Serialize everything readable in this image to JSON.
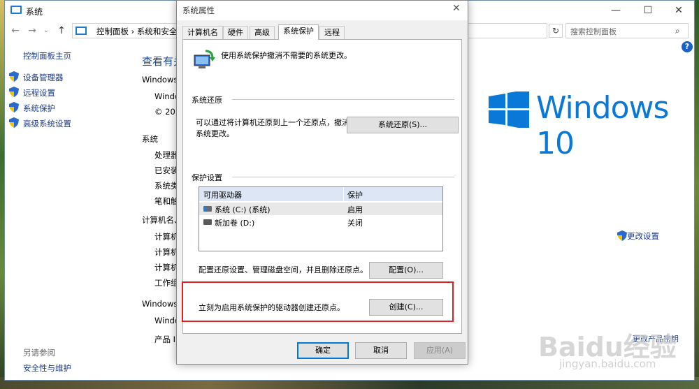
{
  "window": {
    "title": "系统",
    "controls": {
      "minimize": "—",
      "maximize": "☐",
      "close": "✕"
    }
  },
  "address": {
    "path": "控制面板  ›  系统和安全",
    "dropdown": "⌄",
    "refresh": "↻",
    "search_placeholder": "搜索控制面板"
  },
  "sidebar": {
    "home": "控制面板主页",
    "items": [
      {
        "label": "设备管理器"
      },
      {
        "label": "远程设置"
      },
      {
        "label": "系统保护"
      },
      {
        "label": "高级系统设置"
      }
    ],
    "see_also_title": "另请参阅",
    "see_also_link": "安全性与维护"
  },
  "main": {
    "heading": "查看有关",
    "windows_edition_label": "Windows",
    "windows_line": "Windo",
    "copyright": "© 201",
    "system_label": "系统",
    "system_rows": [
      "处理器",
      "已安装",
      "系统类",
      "笔和触"
    ],
    "computer_label": "计算机名、",
    "computer_rows": [
      "计算机",
      "计算机",
      "计算机",
      "工作组"
    ],
    "activation_label": "Windows",
    "activation_rows": [
      "Windo",
      "产品 ID"
    ],
    "win10_text": "Windows 10",
    "change_settings": "更改设置",
    "product_key": "更改产品密钥"
  },
  "dialog": {
    "title": "系统属性",
    "close": "✕",
    "tabs": [
      "计算机名",
      "硬件",
      "高级",
      "系统保护",
      "远程"
    ],
    "active_tab": "系统保护",
    "intro": "使用系统保护撤消不需要的系统更改。",
    "restore_section": "系统还原",
    "restore_text_1": "可以通过将计算机还原到上一个还原点，撤消",
    "restore_text_2": "系统更改。",
    "restore_button": "系统还原(S)...",
    "protection_section": "保护设置",
    "drive_headers": {
      "drive": "可用驱动器",
      "protection": "保护"
    },
    "drives": [
      {
        "name": "系统 (C:) (系统)",
        "status": "启用"
      },
      {
        "name": "新加卷 (D:)",
        "status": "关闭"
      }
    ],
    "configure_text": "配置还原设置、管理磁盘空间，并且删除还原点。",
    "configure_button": "配置(O)...",
    "create_text": "立刻为启用系统保护的驱动器创建还原点。",
    "create_button": "创建(C)...",
    "ok_button": "确定",
    "cancel_button": "取消",
    "apply_button": "应用(A)"
  },
  "watermark": {
    "main": "Baidu经验",
    "sub": "jingyan.baidu.com"
  },
  "colors": {
    "link": "#1a3a8a",
    "win10_blue": "#0a78d7",
    "highlight": "#e02020"
  }
}
